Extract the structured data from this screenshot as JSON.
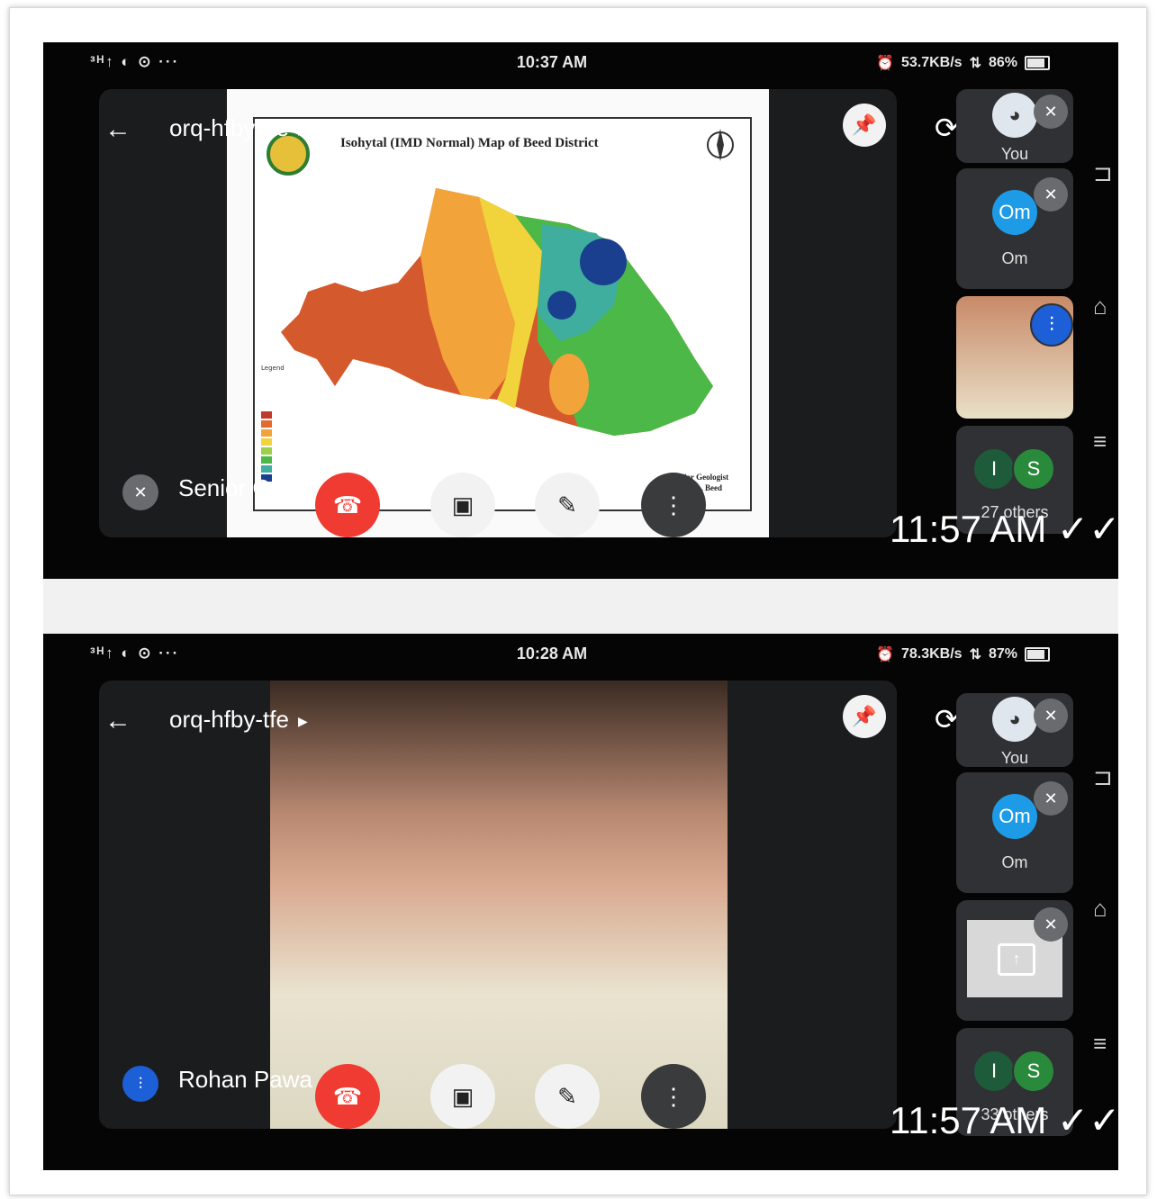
{
  "timestamps": {
    "shot1": "11:57 AM",
    "shot2": "11:57 AM"
  },
  "read_receipt_icon": "double-check-icon",
  "shot1": {
    "status": {
      "left_icons": "³ᴴ↑ ◐ ⊙ ···",
      "time": "10:37 AM",
      "speed": "53.7KB/s",
      "battery": "86%"
    },
    "meeting_code": "orq-hfby-tfe",
    "presentation": {
      "title": "Isohytal (IMD Normal) Map of Beed District",
      "credit_line1": "ior Geologist",
      "credit_line2": "A, Beed",
      "legend_title": "Legend"
    },
    "bottom_name": "Senior Geolo",
    "tiles": {
      "you": "You",
      "om_avatar": "Om",
      "om_label": "Om",
      "avatar_i": "I",
      "avatar_s": "S",
      "others": "27 others"
    }
  },
  "shot2": {
    "status": {
      "left_icons": "³ᴴ↑ ◐ ⊙ ···",
      "time": "10:28 AM",
      "speed": "78.3KB/s",
      "battery": "87%"
    },
    "meeting_code": "orq-hfby-tfe",
    "bottom_name": "Rohan Pawa",
    "tiles": {
      "you": "You",
      "om_avatar": "Om",
      "om_label": "Om",
      "avatar_i": "I",
      "avatar_s": "S",
      "others": "33 others"
    }
  },
  "colors": {
    "end_call": "#f03b33",
    "om_blue": "#1e9be6",
    "avatar_green": "#1e5b3a",
    "avatar_s_green": "#2a8a3c",
    "speaking_blue": "#1d5fd6"
  }
}
